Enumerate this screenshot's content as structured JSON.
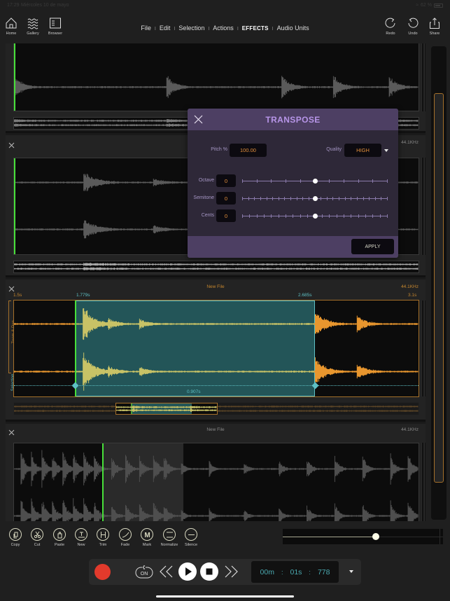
{
  "status_bar": {
    "time": "17:29",
    "date": "Miércoles 10 de mayo",
    "battery": "62 %"
  },
  "toolbar": {
    "left_buttons": [
      {
        "label": "Home",
        "icon": "home-icon"
      },
      {
        "label": "Gallery",
        "icon": "waves-icon"
      },
      {
        "label": "Browser",
        "icon": "browser-icon"
      }
    ],
    "menu": [
      {
        "label": "File",
        "active": false
      },
      {
        "label": "Edit",
        "active": false
      },
      {
        "label": "Selection",
        "active": false
      },
      {
        "label": "Actions",
        "active": false
      },
      {
        "label": "EFFECTS",
        "active": true
      },
      {
        "label": "Audio Units",
        "active": false
      }
    ],
    "right_buttons": [
      {
        "label": "Redo",
        "icon": "redo-icon"
      },
      {
        "label": "Undo",
        "icon": "undo-icon"
      },
      {
        "label": "Share",
        "icon": "share-icon"
      }
    ]
  },
  "tracks": [
    {
      "title": "",
      "sample_rate": ""
    },
    {
      "title": "",
      "sample_rate": "44.1KHz"
    },
    {
      "title": "New File",
      "sample_rate": "44.1KHz",
      "range_start": "1.5s",
      "selection_start": "1.779s",
      "selection_end": "2.685s",
      "range_end": "3.1s",
      "selection_length": "0.907s",
      "side_labels": {
        "zoom_pan": "Zoom & Pan",
        "selection": "Selection"
      }
    },
    {
      "title": "New File",
      "sample_rate": "44.1KHz"
    }
  ],
  "dialog": {
    "title": "TRANSPOSE",
    "pitch_label": "Pitch %",
    "pitch_value": "100.00",
    "quality_label": "Quality",
    "quality_value": "HIGH",
    "sliders": [
      {
        "label": "Octave",
        "value": "0",
        "ticks": 11,
        "position": 0.5
      },
      {
        "label": "Semitone",
        "value": "0",
        "ticks": 25,
        "position": 0.5
      },
      {
        "label": "Cents",
        "value": "0",
        "ticks": 21,
        "position": 0.5
      }
    ],
    "apply_label": "APPLY"
  },
  "tools": [
    {
      "label": "Copy",
      "icon": "copy-icon"
    },
    {
      "label": "Cut",
      "icon": "scissors-icon"
    },
    {
      "label": "Paste",
      "icon": "paste-icon"
    },
    {
      "label": "New",
      "icon": "new-icon"
    },
    {
      "label": "Trim",
      "icon": "trim-icon"
    },
    {
      "label": "Fade",
      "icon": "fade-icon"
    },
    {
      "label": "Mark",
      "icon": "mark-icon"
    },
    {
      "label": "Normalize",
      "icon": "normalize-icon"
    },
    {
      "label": "Silence",
      "icon": "silence-icon"
    }
  ],
  "zoom_slider": {
    "position": 0.59
  },
  "transport": {
    "loop_label": "ON",
    "time": {
      "minutes": "00m",
      "seconds": "01s",
      "millis": "778"
    }
  },
  "colors": {
    "accent_orange": "#e4903c",
    "selection_teal": "#235558",
    "playhead_green": "#48e03a",
    "dialog_purple": "#4d3f63",
    "record_red": "#e23a2c"
  }
}
